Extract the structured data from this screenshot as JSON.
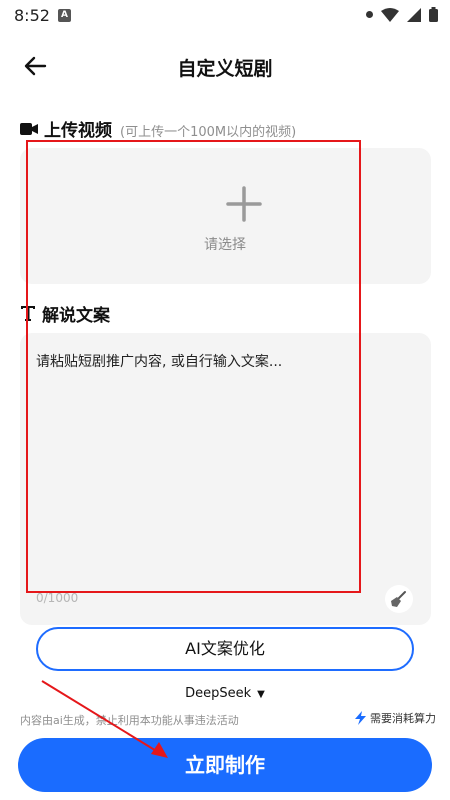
{
  "status_bar": {
    "time": "8:52",
    "notif_glyph": "A"
  },
  "header": {
    "title": "自定义短剧"
  },
  "upload_section": {
    "title": "上传视频",
    "note": "(可上传一个100M以内的视频)",
    "upload_label": "请选择"
  },
  "script_section": {
    "title": "解说文案",
    "placeholder": "请粘贴短剧推广内容, 或自行输入文案...",
    "counter": "0/1000"
  },
  "ai_optimize_label": "AI文案优化",
  "model_select": {
    "value": "DeepSeek"
  },
  "footer": {
    "disclaimer": "内容由ai生成，禁止利用本功能从事违法活动",
    "cost_note": "需要消耗算力"
  },
  "create_button_label": "立即制作",
  "colors": {
    "accent": "#1a6cff",
    "annotation": "#e5171a",
    "panel_bg": "#f4f4f4"
  },
  "icons": [
    "video-camera-icon",
    "text-t-icon",
    "plus-icon",
    "broom-icon",
    "lightning-icon",
    "back-arrow-icon",
    "wifi-icon",
    "signal-icon",
    "battery-icon"
  ]
}
